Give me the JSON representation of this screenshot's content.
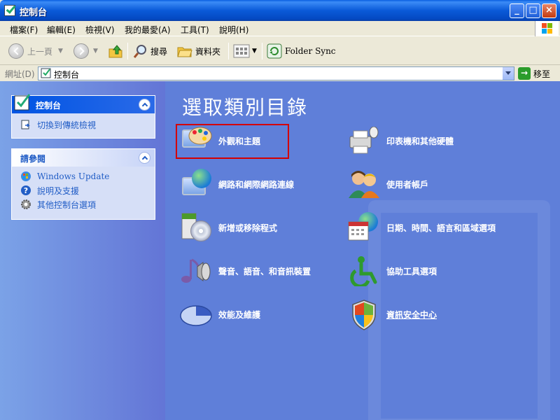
{
  "window": {
    "title": "控制台",
    "buttons": {
      "minimize": "_",
      "maximize": "□",
      "close": "×"
    }
  },
  "menu": {
    "items": [
      "檔案(F)",
      "編輯(E)",
      "檢視(V)",
      "我的最愛(A)",
      "工具(T)",
      "說明(H)"
    ]
  },
  "toolbar": {
    "back_label": "上一頁",
    "search_label": "搜尋",
    "folders_label": "資料夾",
    "folder_sync_label": "Folder Sync"
  },
  "address": {
    "label": "網址(D)",
    "value": "控制台",
    "go_label": "移至"
  },
  "sidebar": {
    "panel1": {
      "title": "控制台",
      "items": [
        {
          "label": "切換到傳統檢視",
          "icon": "switch-view-icon"
        }
      ]
    },
    "panel2": {
      "title": "請參閱",
      "items": [
        {
          "label": "Windows Update",
          "icon": "windows-update-icon"
        },
        {
          "label": "說明及支援",
          "icon": "help-icon"
        },
        {
          "label": "其他控制台選項",
          "icon": "gear-icon"
        }
      ]
    }
  },
  "main": {
    "heading": "選取類別目錄",
    "categories": [
      {
        "label": "外觀和主題",
        "icon": "appearance-themes-icon"
      },
      {
        "label": "印表機和其他硬體",
        "icon": "printer-hardware-icon"
      },
      {
        "label": "網路和網際網路連線",
        "icon": "network-internet-icon"
      },
      {
        "label": "使用者帳戶",
        "icon": "user-accounts-icon"
      },
      {
        "label": "新增或移除程式",
        "icon": "add-remove-programs-icon"
      },
      {
        "label": "日期、時間、語言和區域選項",
        "icon": "date-time-language-icon"
      },
      {
        "label": "聲音、語音、和音訊裝置",
        "icon": "sounds-audio-icon"
      },
      {
        "label": "協助工具選項",
        "icon": "accessibility-icon"
      },
      {
        "label": "效能及維護",
        "icon": "performance-maintenance-icon"
      },
      {
        "label": "資訊安全中心",
        "icon": "security-center-icon"
      }
    ]
  }
}
